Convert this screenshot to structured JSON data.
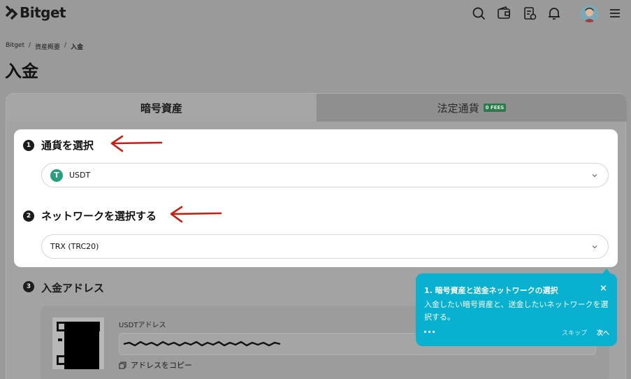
{
  "header": {
    "brand": "Bitget",
    "icons": [
      "search-icon",
      "wallet-icon",
      "orders-icon",
      "bell-icon",
      "avatar",
      "menu-icon"
    ]
  },
  "breadcrumb": {
    "items": [
      "Bitget",
      "資産概要",
      "入金"
    ],
    "separator": "/"
  },
  "page": {
    "title": "入金"
  },
  "tabs": {
    "crypto": "暗号資産",
    "fiat": "法定通貨",
    "fiat_badge": "0 FEES"
  },
  "steps": {
    "step1": {
      "num": "1",
      "label": "通貨を選択",
      "value": "USDT",
      "coin_glyph": "T"
    },
    "step2": {
      "num": "2",
      "label": "ネットワークを選択する",
      "value": "TRX (TRC20)"
    },
    "step3": {
      "num": "3",
      "label": "入金アドレス",
      "address_label": "USDTアドレス",
      "copy_label": "アドレスをコピー"
    }
  },
  "tooltip": {
    "title": "1. 暗号資産と送金ネットワークの選択",
    "close": "×",
    "body": "入金したい暗号資産と、送金したいネットワークを選択する。",
    "skip": "スキップ",
    "next": "次へ"
  },
  "colors": {
    "overlay": "#9a9a9a",
    "tooltip": "#07b1cf",
    "arrow": "#cc1b10",
    "usdt": "#26a17b",
    "badge": "#2f7a4c"
  }
}
